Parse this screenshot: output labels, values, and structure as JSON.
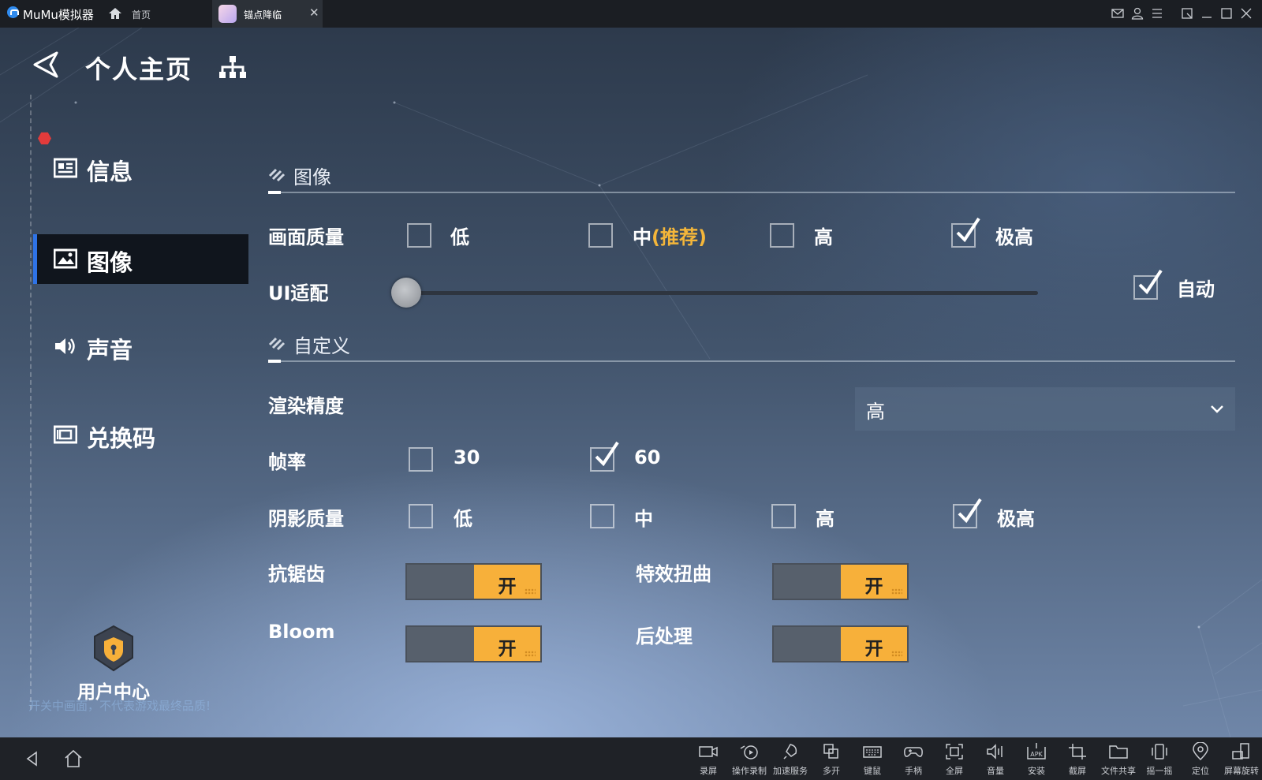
{
  "titlebar": {
    "app_name": "MuMu模拟器",
    "home_tab": "首页",
    "active_tab": "锚点降临",
    "close_glyph": "✕"
  },
  "header": {
    "title": "个人主页"
  },
  "sidebar": {
    "items": [
      {
        "label": "信息",
        "icon": "info-card-icon",
        "active": false
      },
      {
        "label": "图像",
        "icon": "image-icon",
        "active": true
      },
      {
        "label": "声音",
        "icon": "speaker-icon",
        "active": false
      },
      {
        "label": "兑换码",
        "icon": "ticket-icon",
        "active": false
      }
    ],
    "user_center": "用户中心",
    "tip": "开关中画面，不代表游戏最终品质!"
  },
  "image_section": {
    "heading": "图像",
    "quality": {
      "label": "画面质量",
      "options": [
        {
          "label": "低",
          "checked": false
        },
        {
          "label": "中",
          "hint": "(推荐)",
          "checked": false
        },
        {
          "label": "高",
          "checked": false
        },
        {
          "label": "极高",
          "checked": true
        }
      ]
    },
    "ui_adapt": {
      "label": "UI适配",
      "slider_value": 0,
      "auto_label": "自动",
      "auto_checked": true
    }
  },
  "custom_section": {
    "heading": "自定义",
    "render_precision": {
      "label": "渲染精度",
      "value": "高"
    },
    "frame_rate": {
      "label": "帧率",
      "options": [
        {
          "label": "30",
          "checked": false
        },
        {
          "label": "60",
          "checked": true
        }
      ]
    },
    "shadow_quality": {
      "label": "阴影质量",
      "options": [
        {
          "label": "低",
          "checked": false
        },
        {
          "label": "中",
          "checked": false
        },
        {
          "label": "高",
          "checked": false
        },
        {
          "label": "极高",
          "checked": true
        }
      ]
    },
    "toggles": [
      {
        "label": "抗锯齿",
        "state": "开"
      },
      {
        "label": "特效扭曲",
        "state": "开"
      },
      {
        "label": "Bloom",
        "state": "开"
      },
      {
        "label": "后处理",
        "state": "开"
      }
    ]
  },
  "toolbar": {
    "items": [
      "录屏",
      "操作录制",
      "加速服务",
      "多开",
      "键鼠",
      "手柄",
      "全屏",
      "音量",
      "安装",
      "截屏",
      "文件共享",
      "摇一摇",
      "定位",
      "屏幕旋转"
    ]
  },
  "colors": {
    "accent_orange": "#f7b03a",
    "hint_orange": "#f4b63a",
    "active_border": "#2f73e6"
  }
}
